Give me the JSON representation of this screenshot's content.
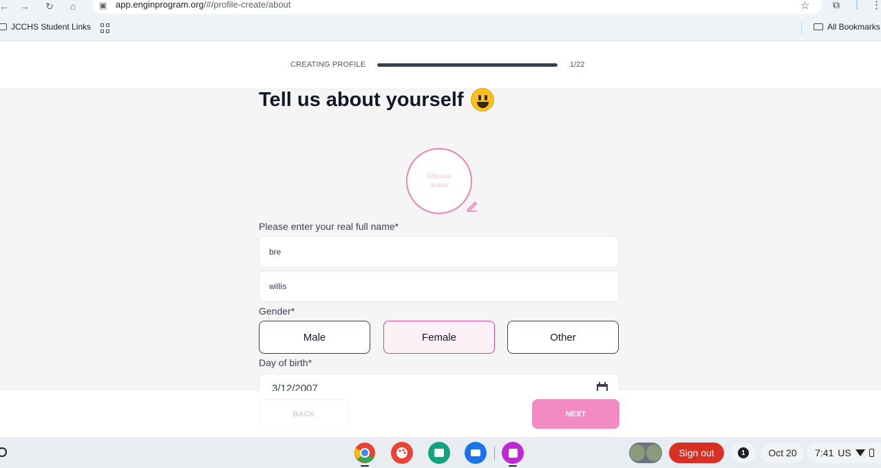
{
  "browser": {
    "url_host": "app.enginprogram.org",
    "url_path": "/#/profile-create/about",
    "bookmark_folder": "JCCHS Student Links",
    "all_bookmarks": "All Bookmarks"
  },
  "progress": {
    "label": "CREATING PROFILE",
    "count": "1/22",
    "value_percent": 100
  },
  "page": {
    "title": "Tell us about yourself",
    "avatar_hint": "Choose avatar",
    "name_label": "Please enter your real full name*",
    "first_name_value": "bre",
    "last_name_value": "willis",
    "gender_label": "Gender*",
    "gender_options": [
      "Male",
      "Female",
      "Other"
    ],
    "gender_selected": "Female",
    "dob_label": "Day of birth*",
    "dob_value": "3/12/2007"
  },
  "footer": {
    "back_label": "BACK",
    "next_label": "NEXT"
  },
  "shelf": {
    "apps": [
      {
        "name": "chrome",
        "color": "#4285f4"
      },
      {
        "name": "palette",
        "color": "#ea4335"
      },
      {
        "name": "classroom",
        "color": "#12a37f"
      },
      {
        "name": "files",
        "color": "#1a73e8"
      },
      {
        "name": "canvas",
        "color": "#c026d3"
      }
    ],
    "signout_label": "Sign out",
    "notification_count": "1",
    "date": "Oct 20",
    "time": "7:41",
    "locale": "US"
  },
  "colors": {
    "accent_pink": "#f18bc2",
    "selected_border": "#d6478b",
    "progress_fill": "#374151"
  }
}
